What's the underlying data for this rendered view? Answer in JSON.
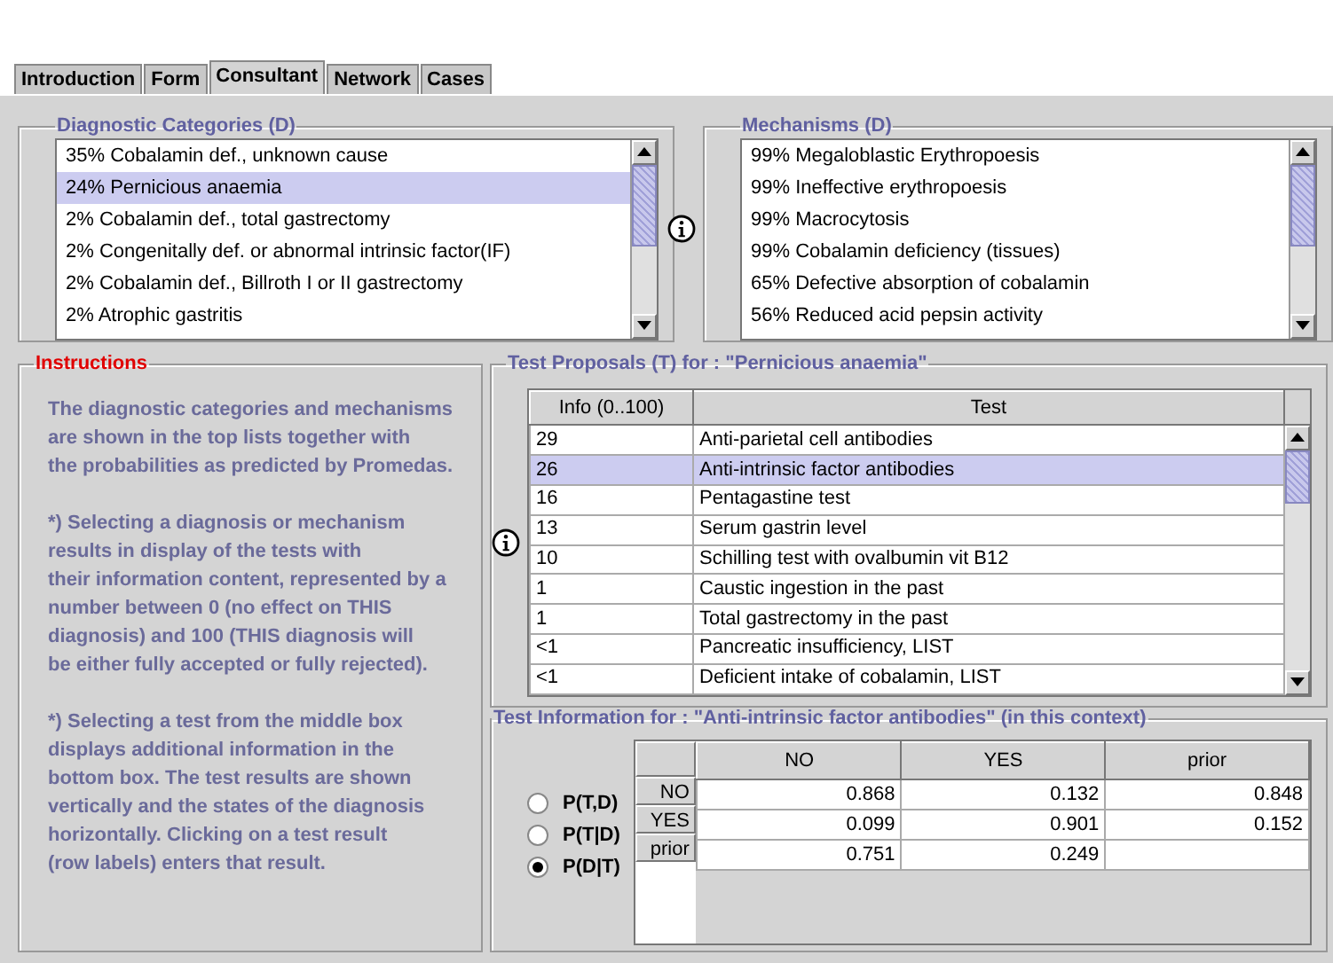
{
  "tabs": [
    {
      "label": "Introduction",
      "selected": false
    },
    {
      "label": "Form",
      "selected": false
    },
    {
      "label": "Consultant",
      "selected": true
    },
    {
      "label": "Network",
      "selected": false
    },
    {
      "label": "Cases",
      "selected": false
    }
  ],
  "diagnostic_categories": {
    "title": "Diagnostic Categories (D)",
    "items": [
      {
        "label": "35% Cobalamin def., unknown cause",
        "selected": false
      },
      {
        "label": "24% Pernicious anaemia",
        "selected": true
      },
      {
        "label": "2% Cobalamin def., total gastrectomy",
        "selected": false
      },
      {
        "label": "2% Congenitally def. or abnormal intrinsic factor(IF)",
        "selected": false
      },
      {
        "label": "2% Cobalamin def., Billroth I or II gastrectomy",
        "selected": false
      },
      {
        "label": "2% Atrophic gastritis",
        "selected": false
      }
    ]
  },
  "mechanisms": {
    "title": "Mechanisms (D)",
    "items": [
      {
        "label": "99% Megaloblastic Erythropoesis",
        "selected": false
      },
      {
        "label": "99% Ineffective erythropoesis",
        "selected": false
      },
      {
        "label": "99% Macrocytosis",
        "selected": false
      },
      {
        "label": "99% Cobalamin deficiency (tissues)",
        "selected": false
      },
      {
        "label": "65% Defective absorption of cobalamin",
        "selected": false
      },
      {
        "label": "56% Reduced acid pepsin activity",
        "selected": false
      }
    ]
  },
  "instructions": {
    "title": "Instructions",
    "paragraphs": [
      "The diagnostic categories and mechanisms\nare shown in the top lists together with\nthe probabilities as predicted by Promedas.",
      "*) Selecting a diagnosis or mechanism\nresults in display of the tests with\ntheir information content, represented by a\nnumber between 0 (no effect on THIS\ndiagnosis) and 100 (THIS diagnosis will\nbe either fully accepted or fully rejected).",
      "*) Selecting a test from the middle box\ndisplays additional information in the\nbottom box. The test results are shown\nvertically and the states of the diagnosis\nhorizontally. Clicking on a test result\n(row labels) enters that result."
    ]
  },
  "test_proposals": {
    "title": "Test Proposals (T) for : \"Pernicious anaemia\"",
    "columns": [
      "Info (0..100)",
      "Test"
    ],
    "rows": [
      {
        "info": "29",
        "test": "Anti-parietal cell antibodies",
        "selected": false
      },
      {
        "info": "26",
        "test": "Anti-intrinsic factor antibodies",
        "selected": true
      },
      {
        "info": "16",
        "test": "Pentagastine test",
        "selected": false
      },
      {
        "info": "13",
        "test": "Serum gastrin level",
        "selected": false
      },
      {
        "info": "10",
        "test": "Schilling test with ovalbumin vit B12",
        "selected": false
      },
      {
        "info": "1",
        "test": "Caustic ingestion in the past",
        "selected": false
      },
      {
        "info": "1",
        "test": "Total gastrectomy in the past",
        "selected": false
      },
      {
        "info": "<1",
        "test": "Pancreatic insufficiency, LIST",
        "selected": false
      },
      {
        "info": "<1",
        "test": "Deficient intake of cobalamin, LIST",
        "selected": false
      }
    ]
  },
  "test_information": {
    "title": "Test Information for : \"Anti-intrinsic factor antibodies\" (in this context)",
    "options": [
      {
        "label": "P(T,D)",
        "selected": false
      },
      {
        "label": "P(T|D)",
        "selected": false
      },
      {
        "label": "P(D|T)",
        "selected": true
      }
    ],
    "columns": [
      "NO",
      "YES",
      "prior"
    ],
    "rows": [
      {
        "label": "NO",
        "values": [
          "0.868",
          "0.132",
          "0.848"
        ]
      },
      {
        "label": "YES",
        "values": [
          "0.099",
          "0.901",
          "0.152"
        ]
      },
      {
        "label": "prior",
        "values": [
          "0.751",
          "0.249"
        ]
      }
    ]
  }
}
